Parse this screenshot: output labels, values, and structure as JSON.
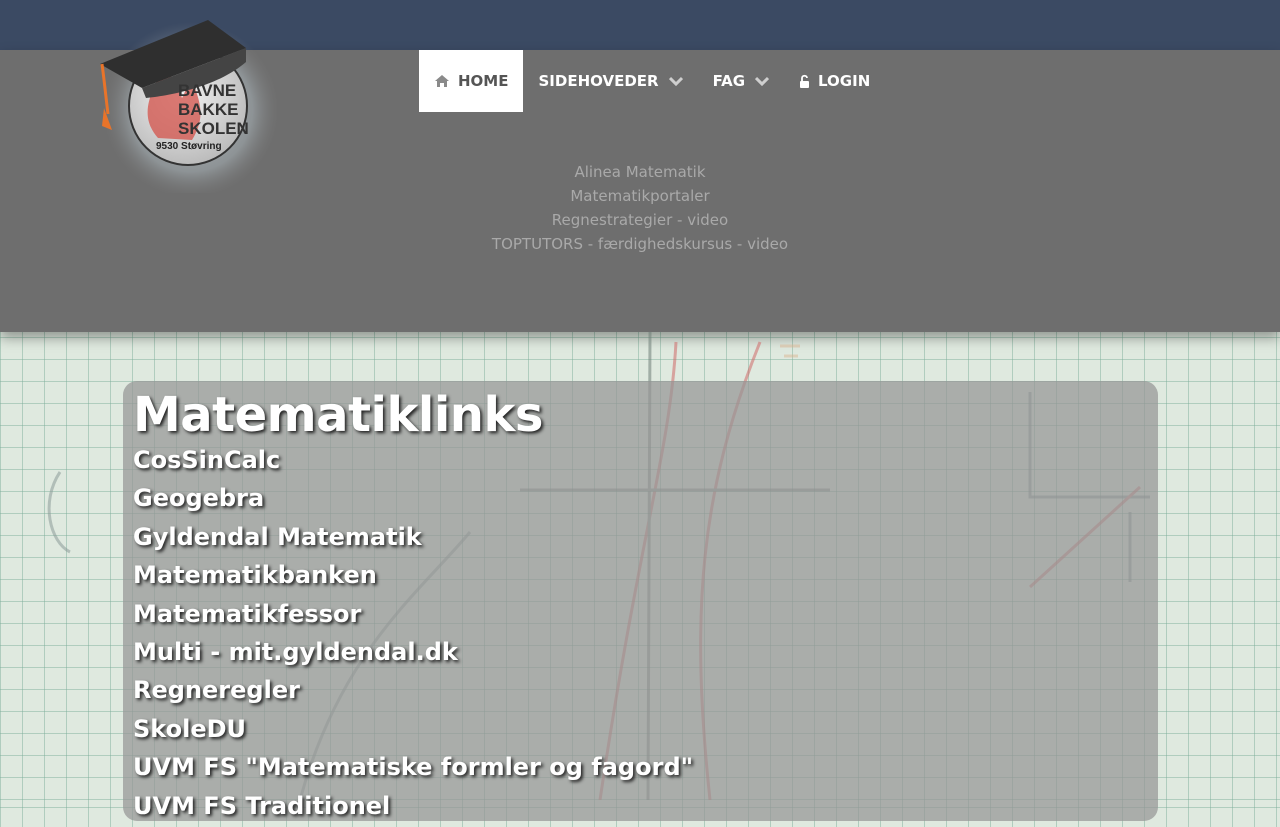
{
  "nav": {
    "items": [
      {
        "label": "HOME",
        "icon": "home-icon",
        "active": true,
        "has_dropdown": false
      },
      {
        "label": "SIDEHOVEDER",
        "icon": "",
        "active": false,
        "has_dropdown": true
      },
      {
        "label": "FAG",
        "icon": "",
        "active": false,
        "has_dropdown": true
      },
      {
        "label": "LOGIN",
        "icon": "lock-icon",
        "active": false,
        "has_dropdown": false
      }
    ]
  },
  "logo": {
    "line1": "BAVNE",
    "line2": "BAKKE",
    "line3": "SKOLEN",
    "place": "9530 Støvring"
  },
  "submenu": {
    "items": [
      "Alinea Matematik",
      "Matematikportaler",
      "Regnestrategier - video",
      "TOPTUTORS - færdighedskursus - video"
    ]
  },
  "main": {
    "title": "Matematiklinks",
    "links": [
      "CosSinCalc",
      "Geogebra",
      "Gyldendal Matematik",
      "Matematikbanken",
      "Matematikfessor",
      "Multi - mit.gyldendal.dk",
      "Regneregler",
      "SkoleDU",
      "UVM FS \"Matematiske formler og fagord\"",
      "UVM FS Traditionel"
    ]
  },
  "colors": {
    "topbar": "#3b4a63",
    "header": "#6e6e6e",
    "accent_orange": "#e8742a"
  }
}
